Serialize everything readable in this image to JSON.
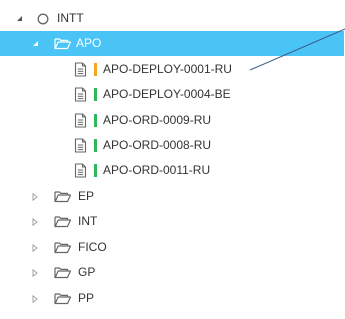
{
  "tree": {
    "root": {
      "label": "INTT",
      "expanded": true
    },
    "selected_folder": {
      "label": "APO",
      "expanded": true
    },
    "documents": [
      {
        "label": "APO-DEPLOY-0001-RU",
        "status_color": "#f5a623"
      },
      {
        "label": "APO-DEPLOY-0004-BE",
        "status_color": "#2db85c"
      },
      {
        "label": "APO-ORD-0009-RU",
        "status_color": "#2db85c"
      },
      {
        "label": "APO-ORD-0008-RU",
        "status_color": "#2db85c"
      },
      {
        "label": "APO-ORD-0011-RU",
        "status_color": "#2db85c"
      }
    ],
    "folders": [
      {
        "label": "EP",
        "expanded": false
      },
      {
        "label": "INT",
        "expanded": false
      },
      {
        "label": "FICO",
        "expanded": false
      },
      {
        "label": "GP",
        "expanded": false
      },
      {
        "label": "PP",
        "expanded": false
      }
    ]
  },
  "colors": {
    "selection": "#49c4f5",
    "icon_gray": "#666666",
    "connector_line": "#3a5a8a"
  }
}
